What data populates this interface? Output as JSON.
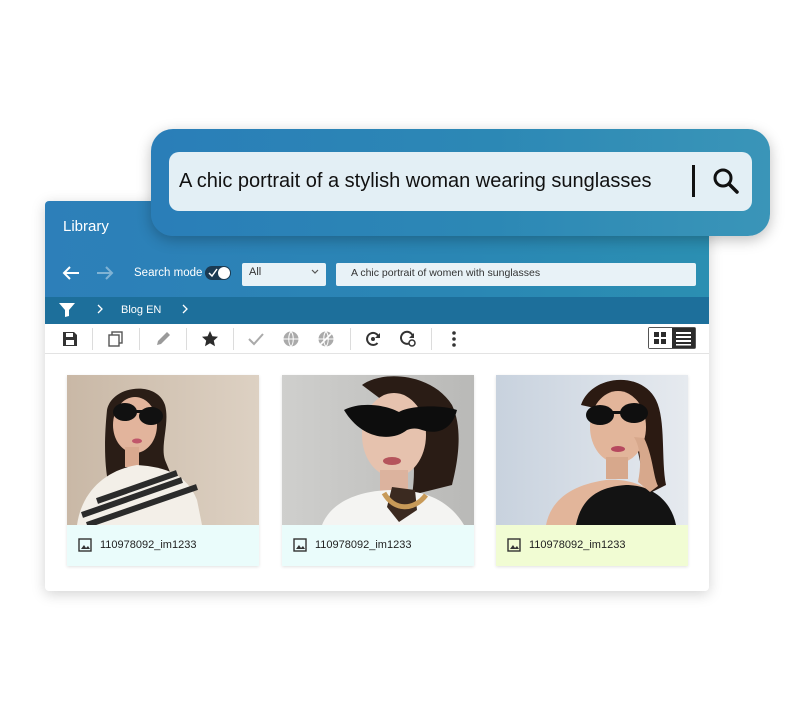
{
  "library": {
    "title": "Library",
    "search_mode_label": "Search mode",
    "search_mode_on": true,
    "filter_select": {
      "selected": "All"
    },
    "query_value": "A chic portrait of women with sunglasses",
    "breadcrumb": [
      "Blog EN"
    ],
    "toolbar_icons": [
      "save-icon",
      "copy-icon",
      "pencil-icon",
      "star-icon",
      "check-icon",
      "globe-icon",
      "globe-off-icon",
      "sync-icon",
      "sync-settings-icon",
      "more-vert-icon"
    ],
    "view_mode": "grid"
  },
  "cards": [
    {
      "filename": "110978092_im1233",
      "footer_color": "#eafcfb"
    },
    {
      "filename": "110978092_im1233",
      "footer_color": "#eafcfb"
    },
    {
      "filename": "110978092_im1233",
      "footer_color": "#f1fcd3"
    }
  ],
  "ai_search": {
    "query": "A chic portrait of a stylish woman wearing sunglasses"
  },
  "colors": {
    "header_blue": "#2d7fb9",
    "breadcrumb_blue": "#1d6f9b",
    "input_bg": "#e8f2f7"
  }
}
